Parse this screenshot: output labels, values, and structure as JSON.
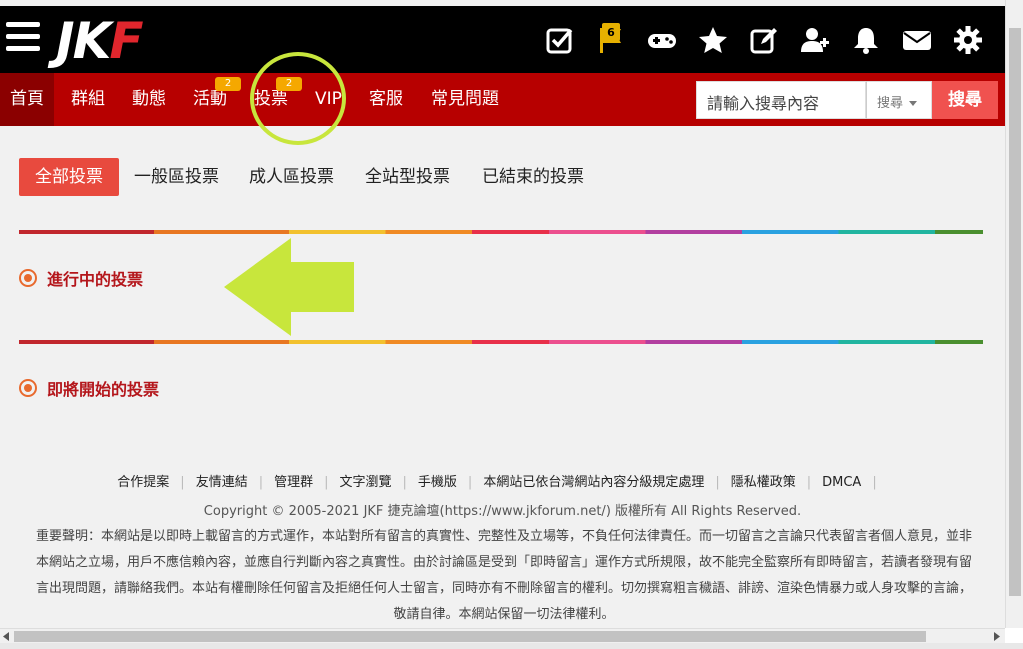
{
  "logo": {
    "part1": "JK",
    "part2": "F"
  },
  "top_icons": [
    {
      "name": "checkbox-icon"
    },
    {
      "name": "flag-icon",
      "badge": "6"
    },
    {
      "name": "gamepad-icon"
    },
    {
      "name": "star-icon"
    },
    {
      "name": "edit-icon"
    },
    {
      "name": "add-user-icon"
    },
    {
      "name": "bell-icon"
    },
    {
      "name": "mail-icon"
    },
    {
      "name": "gear-icon"
    }
  ],
  "nav": {
    "home": "首頁",
    "groups": "群組",
    "feed": "動態",
    "events": "活動",
    "events_badge": "2",
    "votes": "投票",
    "votes_badge": "2",
    "vip": "VIP",
    "service": "客服",
    "faq": "常見問題"
  },
  "search": {
    "placeholder": "請輸入搜尋內容",
    "select_value": "搜尋",
    "button": "搜尋"
  },
  "tabs": {
    "all": "全部投票",
    "general": "一般區投票",
    "adult": "成人區投票",
    "site": "全站型投票",
    "ended": "已結束的投票"
  },
  "sections": {
    "ongoing": "進行中的投票",
    "upcoming": "即將開始的投票"
  },
  "footer": {
    "links": [
      "合作提案",
      "友情連結",
      "管理群",
      "文字瀏覽",
      "手機版",
      "本網站已依台灣網站內容分級規定處理",
      "隱私權政策",
      "DMCA"
    ],
    "copyright": "Copyright © 2005-2021 JKF 捷克論壇(https://www.jkforum.net/) 版權所有 All Rights Reserved.",
    "disclaimer_1": "重要聲明：本網站是以即時上載留言的方式運作，本站對所有留言的真實性、完整性及立場等，不負任何法律責任。而一切留言之言論只代表留言者個人意見，並非",
    "disclaimer_2": "本網站之立場，用戶不應信賴內容，並應自行判斷內容之真實性。由於討論區是受到「即時留言」運作方式所規限，故不能完全監察所有即時留言，若讀者發現有留",
    "disclaimer_3": "言出現問題，請聯絡我們。本站有權刪除任何留言及拒絕任何人士留言，同時亦有不刪除留言的權利。切勿撰寫粗言穢語、誹謗、渲染色情暴力或人身攻擊的言論，",
    "disclaimer_4": "敬請自律。本網站保留一切法律權利。"
  },
  "colors": {
    "nav_red": "#b70000",
    "accent": "#e84a3e",
    "annotation": "#c8e63c"
  }
}
